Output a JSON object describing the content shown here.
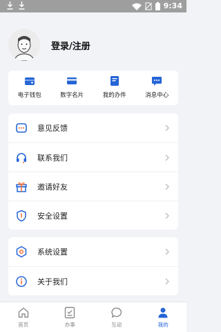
{
  "status_bar": {
    "time": "9:34",
    "left_icons": [
      "download-icon",
      "download-icon"
    ],
    "right_icons": [
      "wifi-icon",
      "no-sim-icon",
      "battery-icon"
    ]
  },
  "profile": {
    "login_label": "登录/注册",
    "avatar_icon": "default-avatar-icon"
  },
  "quick_actions": [
    {
      "label": "电子钱包",
      "icon": "wallet-icon"
    },
    {
      "label": "数字名片",
      "icon": "card-icon"
    },
    {
      "label": "我的办件",
      "icon": "document-icon"
    },
    {
      "label": "消息中心",
      "icon": "message-icon"
    }
  ],
  "menu_group1": [
    {
      "label": "意见反馈",
      "icon": "feedback-icon"
    },
    {
      "label": "联系我们",
      "icon": "headset-icon"
    },
    {
      "label": "邀请好友",
      "icon": "gift-icon"
    },
    {
      "label": "安全设置",
      "icon": "shield-icon"
    }
  ],
  "menu_group2": [
    {
      "label": "系统设置",
      "icon": "gear-icon"
    },
    {
      "label": "关于我们",
      "icon": "info-icon"
    }
  ],
  "tabs": [
    {
      "label": "首页",
      "icon": "home-icon",
      "active": false
    },
    {
      "label": "办事",
      "icon": "task-icon",
      "active": false
    },
    {
      "label": "互动",
      "icon": "chat-icon",
      "active": false
    },
    {
      "label": "我的",
      "icon": "user-icon",
      "active": true
    }
  ],
  "colors": {
    "accent": "#2565d6",
    "icon_orange": "#f2703a",
    "background": "#f2f3f7",
    "status_bar": "#9e9e9e"
  }
}
